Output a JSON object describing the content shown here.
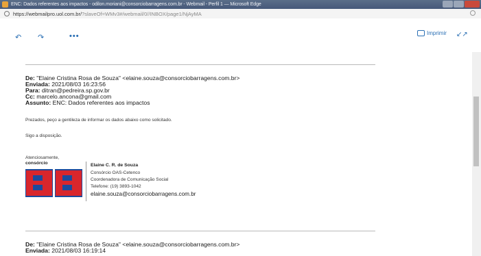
{
  "window": {
    "title": "ENC: Dados referentes aos impactos - odilon.moriani@consorciobarragens.com.br - Webmail - Perfil 1 — Microsoft Edge"
  },
  "address": {
    "url_main": "https://webmailpro.uol.com.br/",
    "url_rest": "?slaveOf=WMv3#/webmail/0//INBOX/page1/NjAyMA"
  },
  "toolbar": {
    "print_label": "Imprimir",
    "more_label": "•••"
  },
  "message1": {
    "from_label": "De:",
    "from_value": "\"Elaine Cristina Rosa de Souza\" <elaine.souza@consorciobarragens.com.br>",
    "sent_label": "Enviada:",
    "sent_value": "2021/08/03 16:23:56",
    "to_label": "Para:",
    "to_value": "ditran@pedreira.sp.gov.br",
    "cc_label": "Cc:",
    "cc_value": "marcelo.ancona@gmail.com",
    "subject_label": "Assunto:",
    "subject_value": "ENC: Dados referentes aos impactos",
    "body_line1": "Prezados, peço a gentileza de informar os dados abaixo como solicitado.",
    "body_line2": "Sigo a disposição.",
    "regards": "Atenciosamente,",
    "logo_word": "consórcio",
    "sig_name": "Elaine C. R. de Souza",
    "sig_org": "Consórcio OAS-Cetenco",
    "sig_role": "Coordenadora de Comunicação Social",
    "sig_phone": "Telefone: (19) 3893-1042",
    "sig_email": "elaine.souza@consorciobarragens.com.br"
  },
  "message2": {
    "from_label": "De:",
    "from_value": "\"Elaine Cristina Rosa de Souza\" <elaine.souza@consorciobarragens.com.br>",
    "sent_label": "Enviada:",
    "sent_value": "2021/08/03 16:19:14"
  }
}
